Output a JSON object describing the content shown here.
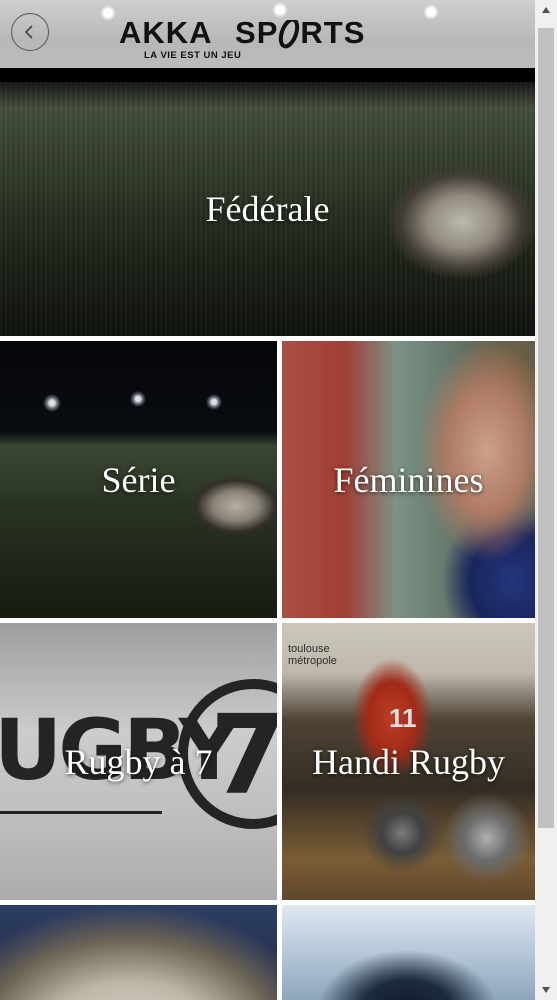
{
  "header": {
    "brand_left": "AKKA",
    "brand_right_pre": "SP",
    "brand_right_post": "RTS",
    "tagline": "LA VIE EST UN JEU",
    "back_icon": "chevron-left-icon"
  },
  "tiles": [
    {
      "label": "Fédérale"
    },
    {
      "label": "Série"
    },
    {
      "label": "Féminines"
    },
    {
      "label": "Rugby à 7"
    },
    {
      "label": "Handi Rugby"
    },
    {
      "label": ""
    },
    {
      "label": ""
    }
  ],
  "photo_text": {
    "rugby7_word": "UGBY",
    "rugby7_number": "7",
    "handi_jersey_number": "11",
    "handi_banner": "toulouse métropole"
  },
  "colors": {
    "header_bg": "#c4c4c4",
    "label_text": "#ffffff",
    "scrollbar_thumb": "#c1c1c1"
  }
}
